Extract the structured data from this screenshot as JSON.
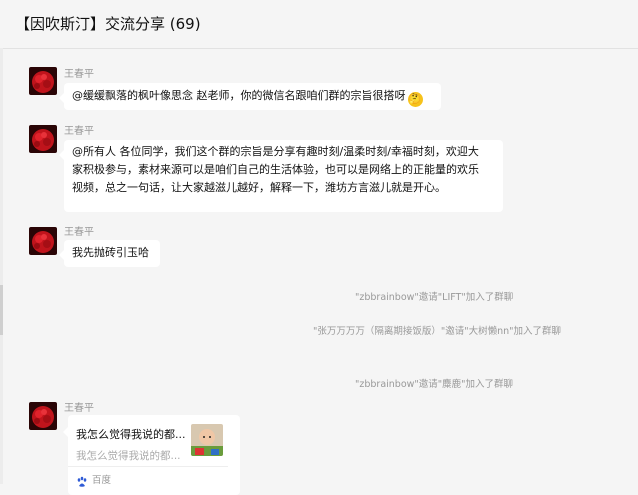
{
  "window": {
    "title": "【因吹斯汀】交流分享 (69)"
  },
  "messages": [
    {
      "sender": "王春平",
      "text": "@缓缓飘落的枫叶像思念 赵老师，你的微信名跟咱们群的宗旨很搭呀",
      "emoji": "thinking-face"
    },
    {
      "sender": "王春平",
      "lines": [
        "@所有人 各位同学，我们这个群的宗旨是分享有趣时刻/温柔时刻/幸福时刻，欢迎大",
        "家积极参与，素材来源可以是咱们自己的生活体验，也可以是网络上的正能量的欢乐",
        "视频，总之一句话，让大家越滋儿越好，解释一下，潍坊方言滋儿就是开心。"
      ]
    },
    {
      "sender": "王春平",
      "text": "我先抛砖引玉哈"
    },
    {
      "sender": "王春平",
      "card": {
        "title": "我怎么觉得我说的都...",
        "desc": "我怎么觉得我说的都...",
        "source": "百度",
        "source_icon": "baidu-paw-icon"
      }
    }
  ],
  "system_notices": [
    "\"zbbrainbow\"邀请\"LIFT\"加入了群聊",
    "\"张万万万万（隔离期接饭版）\"邀请\"大树懒nn\"加入了群聊",
    "\"zbbrainbow\"邀请\"麋鹿\"加入了群聊"
  ],
  "colors": {
    "background": "#f5f5f5",
    "bubble": "#ffffff",
    "muted_text": "#999999",
    "avatar_red": "#c0141c"
  }
}
